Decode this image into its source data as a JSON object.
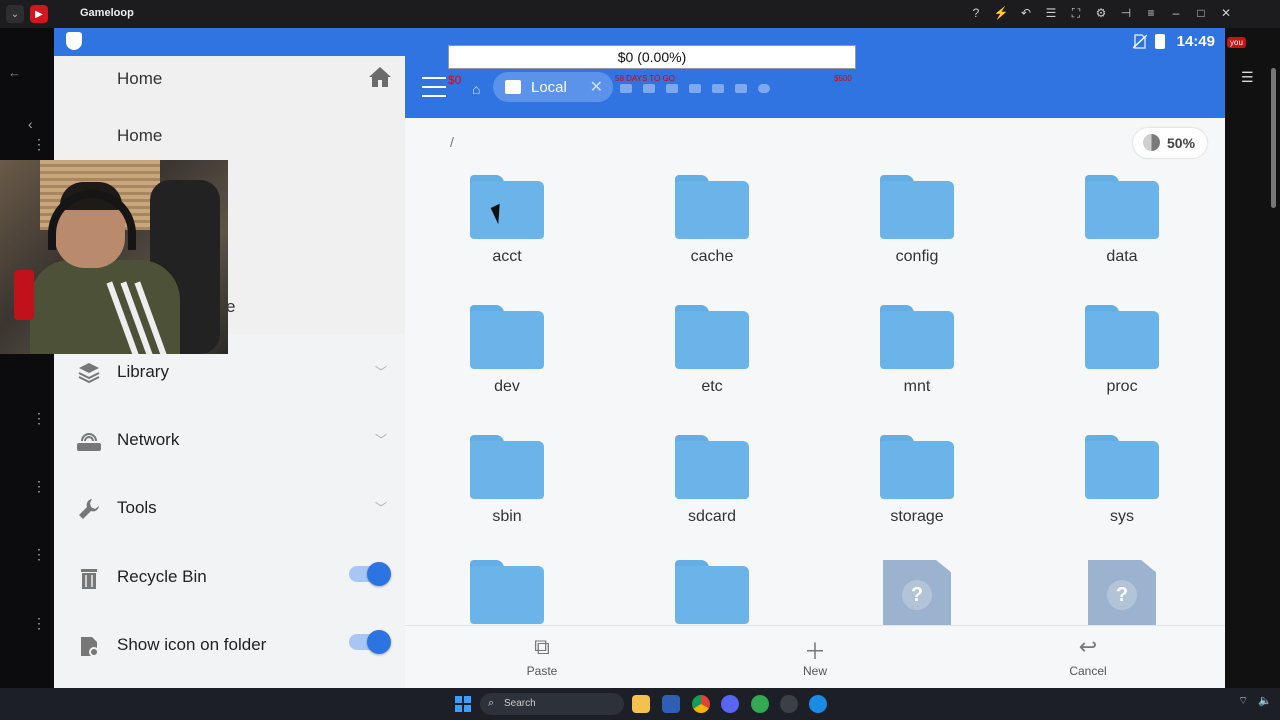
{
  "window": {
    "title": "Gameloop"
  },
  "statusbar": {
    "time": "14:49"
  },
  "overlay": {
    "counter": "$0 (0.00%)",
    "zero": "$0",
    "days": "58 DAYS TO GO",
    "goal": "$500"
  },
  "drawer": {
    "top_title": "Home",
    "home_label": "Home",
    "partial_label": "e",
    "items": [
      {
        "label": "Library",
        "icon": "layers-icon",
        "control": "chevron"
      },
      {
        "label": "Network",
        "icon": "router-icon",
        "control": "chevron"
      },
      {
        "label": "Tools",
        "icon": "wrench-icon",
        "control": "chevron"
      },
      {
        "label": "Recycle Bin",
        "icon": "trash-icon",
        "control": "toggle",
        "on": true
      },
      {
        "label": "Show icon on folder",
        "icon": "folder-badge-icon",
        "control": "toggle",
        "on": true
      }
    ]
  },
  "appbar": {
    "tab_label": "Local"
  },
  "content": {
    "path": "/",
    "storage_percent": "50%",
    "files": [
      {
        "name": "acct",
        "type": "folder"
      },
      {
        "name": "cache",
        "type": "folder"
      },
      {
        "name": "config",
        "type": "folder"
      },
      {
        "name": "data",
        "type": "folder"
      },
      {
        "name": "dev",
        "type": "folder"
      },
      {
        "name": "etc",
        "type": "folder"
      },
      {
        "name": "mnt",
        "type": "folder"
      },
      {
        "name": "proc",
        "type": "folder"
      },
      {
        "name": "sbin",
        "type": "folder"
      },
      {
        "name": "sdcard",
        "type": "folder"
      },
      {
        "name": "storage",
        "type": "folder"
      },
      {
        "name": "sys",
        "type": "folder"
      },
      {
        "name": "",
        "type": "folder"
      },
      {
        "name": "",
        "type": "folder"
      },
      {
        "name": "",
        "type": "unknown"
      },
      {
        "name": "",
        "type": "unknown"
      }
    ]
  },
  "bottombar": {
    "paste": "Paste",
    "new": "New",
    "cancel": "Cancel"
  },
  "taskbar": {
    "search_placeholder": "Search"
  },
  "host": {
    "right_label": "you"
  }
}
